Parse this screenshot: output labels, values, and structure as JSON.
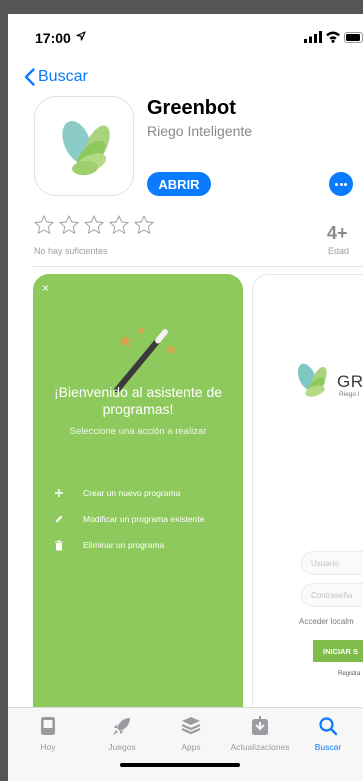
{
  "status": {
    "time": "17:00"
  },
  "nav": {
    "back_label": "Buscar"
  },
  "app": {
    "title": "Greenbot",
    "subtitle": "Riego Inteligente",
    "open_label": "ABRIR",
    "rating_note": "No hay suficientes",
    "age_value": "4+",
    "age_label": "Edad"
  },
  "screenshot1": {
    "close": "×",
    "welcome": "¡Bienvenido al asistente de programas!",
    "subtitle": "Seleccione una acción a realizar",
    "options": [
      {
        "label": "Crear un nuevo programa",
        "icon": "plus-icon"
      },
      {
        "label": "Modificar un programa existente",
        "icon": "pencil-icon"
      },
      {
        "label": "Eliminar un programa",
        "icon": "trash-icon"
      }
    ]
  },
  "screenshot2": {
    "brand": "GRE",
    "tagline": "Riego I",
    "username_placeholder": "Usuario",
    "password_placeholder": "Contraseña",
    "local_link": "Acceder localm",
    "login_button": "INICIAR S",
    "register": "Registra"
  },
  "tabbar": {
    "tabs": [
      {
        "label": "Hoy",
        "icon": "today-icon",
        "active": false
      },
      {
        "label": "Juegos",
        "icon": "rocket-icon",
        "active": false
      },
      {
        "label": "Apps",
        "icon": "apps-stack-icon",
        "active": false
      },
      {
        "label": "Actualizaciones",
        "icon": "updates-icon",
        "active": false
      },
      {
        "label": "Buscar",
        "icon": "search-icon",
        "active": true
      }
    ]
  },
  "colors": {
    "accent": "#0a7aff",
    "green": "#8ec95d"
  }
}
